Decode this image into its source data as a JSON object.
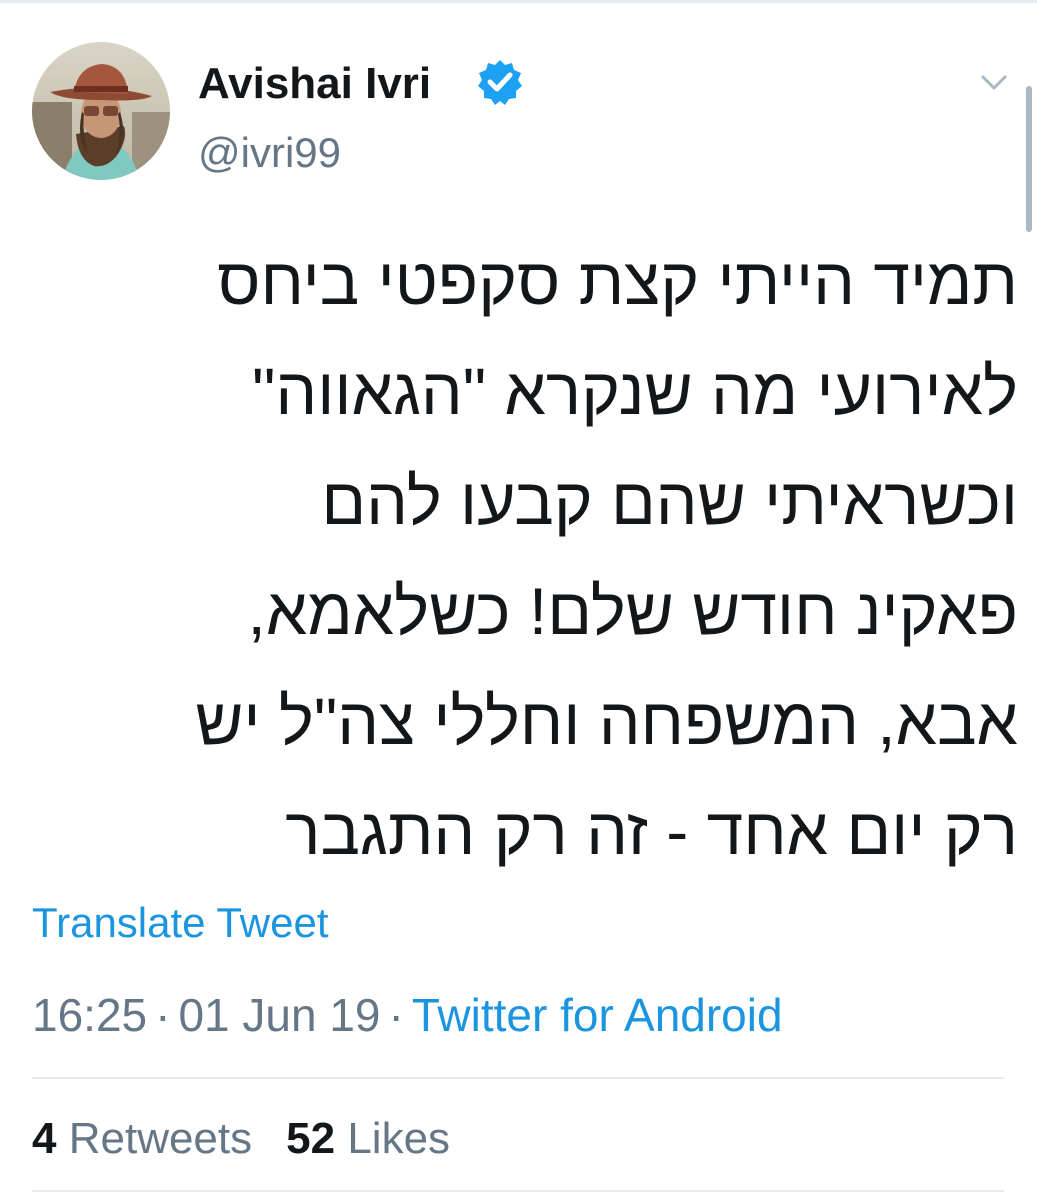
{
  "user": {
    "name": "Avishai Ivri",
    "handle": "@ivri99",
    "verified_color": "#1da1f2"
  },
  "tweet": {
    "lines": [
      "תמיד הייתי קצת סקפטי ביחס",
      "לאירועי מה שנקרא \"הגאווה\"",
      "וכשראיתי שהם קבעו להם",
      "פאקינ חודש שלם! כשלאמא,",
      "אבא, המשפחה וחללי צה\"ל יש",
      "רק יום אחד - זה רק התגבר"
    ],
    "translate_label": "Translate Tweet",
    "time": "16:25",
    "date": "01 Jun 19",
    "separator": "·",
    "source": "Twitter for Android"
  },
  "stats": {
    "retweets_count": "4",
    "retweets_label": "Retweets",
    "likes_count": "52",
    "likes_label": "Likes"
  },
  "icons": {
    "caret": "chevron-down-icon",
    "verified": "verified-badge-icon"
  },
  "colors": {
    "link": "#1b95e0",
    "secondary": "#657786",
    "primary": "#14171a",
    "divider": "#e6ecf0"
  }
}
